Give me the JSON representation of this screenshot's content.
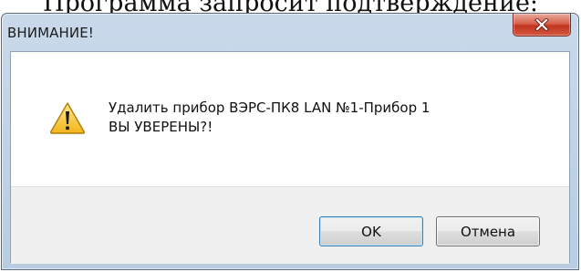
{
  "document": {
    "caption": "Программа запросит подтверждение:"
  },
  "window": {
    "title": "ВНИМАНИЕ!",
    "close_icon": "close-icon",
    "accent_close": "#c2351f"
  },
  "dialog": {
    "icon": "warning-icon",
    "message_line1": "Удалить прибор ВЭРС-ПК8 LAN №1-Прибор 1",
    "message_line2": "ВЫ УВЕРЕНЫ?!"
  },
  "buttons": {
    "ok_label": "OK",
    "cancel_label": "Отмена"
  }
}
